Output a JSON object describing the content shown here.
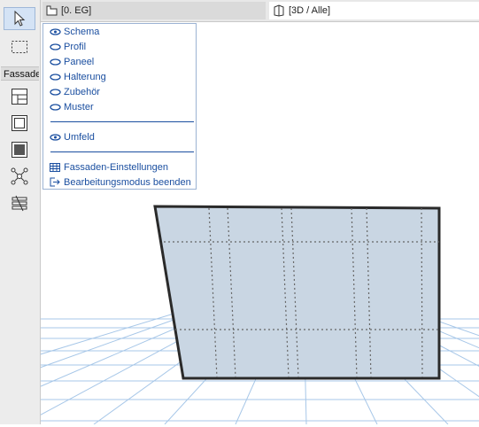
{
  "tabs": {
    "floor_plan": "[0. EG]",
    "view_3d": "[3D / Alle]"
  },
  "toolbar": {
    "section_label": "Fassade",
    "tools": [
      "pointer-arrow-icon",
      "marquee-icon",
      "curtain-wall-icon",
      "frame-icon",
      "panel-icon",
      "junction-icon",
      "accessory-icon"
    ]
  },
  "menu": {
    "show_items": [
      "Schema",
      "Profil",
      "Paneel",
      "Halterung",
      "Zubehör",
      "Muster"
    ],
    "context_item": "Umfeld",
    "settings_item": "Fassaden-Einstellungen",
    "exit_item": "Bearbeitungsmodus beenden"
  },
  "colors": {
    "menu_text": "#1b4fa0",
    "panel_fill": "#c9d6e3",
    "grid_line": "#a7c7e8",
    "selected_tool": "#d4e3f5"
  }
}
